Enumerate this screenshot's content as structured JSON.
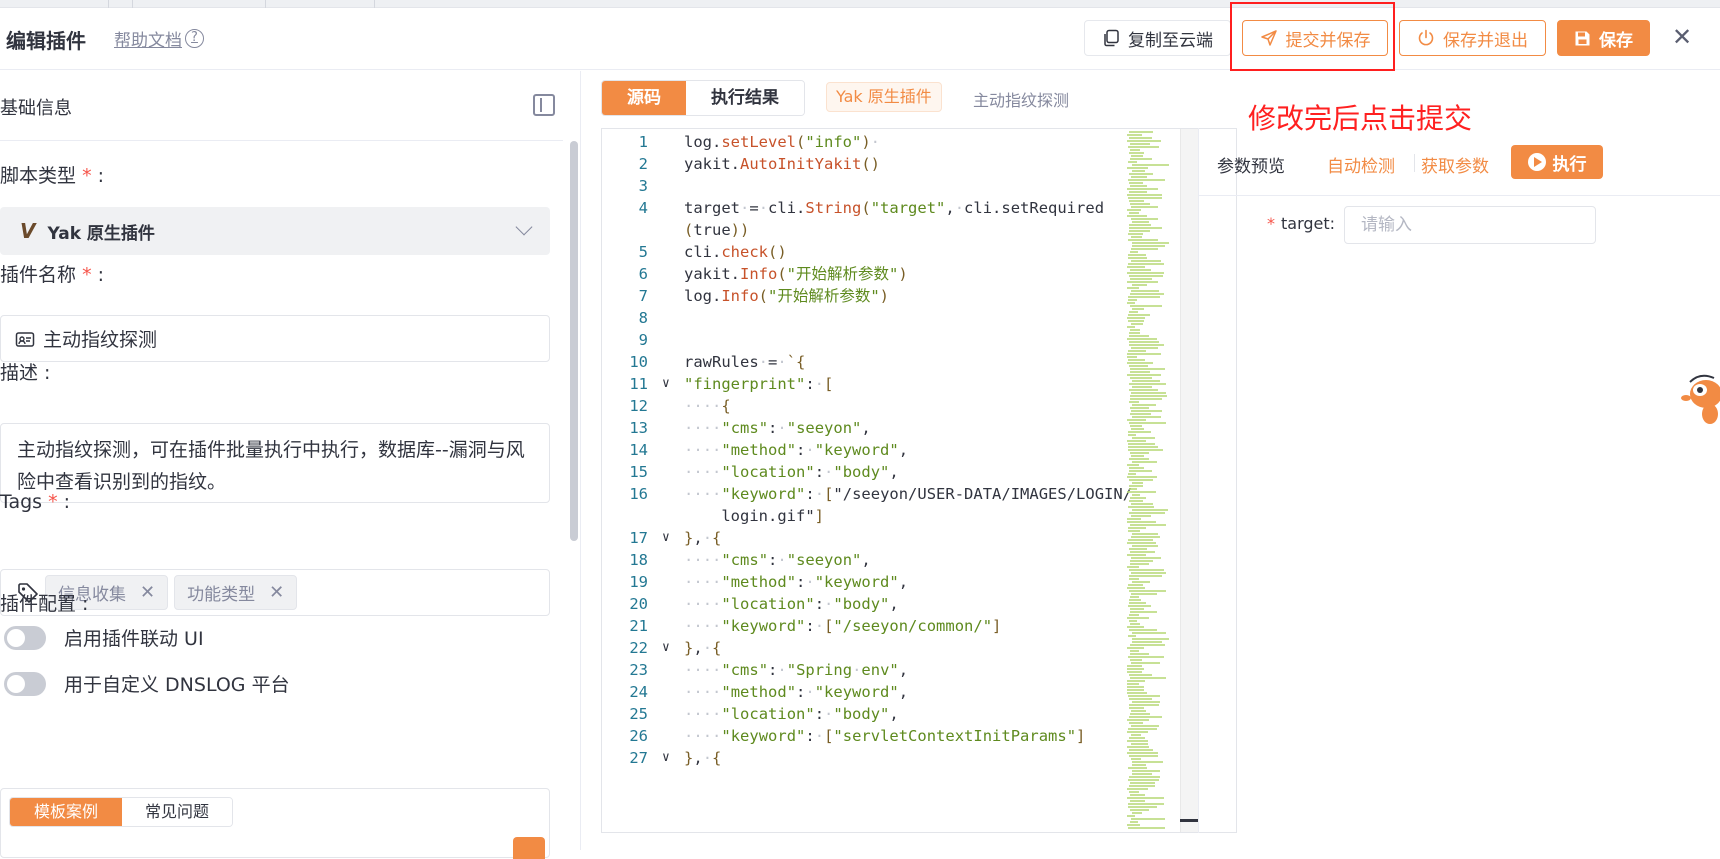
{
  "header": {
    "title": "编辑插件",
    "help_link": "帮助文档",
    "copy_cloud": "复制至云端",
    "submit_save": "提交并保存",
    "save_exit": "保存并退出",
    "save": "保存",
    "annotation": "修改完后点击提交"
  },
  "left": {
    "section_title": "基础信息",
    "script_type_label": "脚本类型",
    "script_type_value": "Yak 原生插件",
    "plugin_name_label": "插件名称",
    "plugin_name_value": "主动指纹探测",
    "desc_label": "描述",
    "desc_value": "主动指纹探测，可在插件批量执行中执行，数据库--漏洞与风险中查看识别到的指纹。",
    "tags_label": "Tags",
    "tags": [
      "信息收集",
      "功能类型"
    ],
    "config_label": "插件配置",
    "switch_linkage": "启用插件联动 UI",
    "switch_dnslog": "用于自定义 DNSLOG 平台",
    "tpl_tab_examples": "模板案例",
    "tpl_tab_faq": "常见问题"
  },
  "right": {
    "tab_source": "源码",
    "tab_result": "执行结果",
    "type_badge": "Yak 原生插件",
    "plugin_name": "主动指纹探测",
    "params_title": "参数预览",
    "auto_detect": "自动检测",
    "get_params": "获取参数",
    "run": "执行",
    "target_label": "target:",
    "target_placeholder": "请输入"
  },
  "code_lines": [
    {
      "n": "1",
      "fold": "",
      "text": "log.setLevel(\"info\")·"
    },
    {
      "n": "2",
      "fold": "",
      "text": "yakit.AutoInitYakit()"
    },
    {
      "n": "3",
      "fold": "",
      "text": ""
    },
    {
      "n": "4",
      "fold": "",
      "text": "target·=·cli.String(\"target\",·cli.setRequired"
    },
    {
      "n": "",
      "fold": "",
      "text": "(true))"
    },
    {
      "n": "5",
      "fold": "",
      "text": "cli.check()"
    },
    {
      "n": "6",
      "fold": "",
      "text": "yakit.Info(\"开始解析参数\")"
    },
    {
      "n": "7",
      "fold": "",
      "text": "log.Info(\"开始解析参数\")"
    },
    {
      "n": "8",
      "fold": "",
      "text": ""
    },
    {
      "n": "9",
      "fold": "",
      "text": ""
    },
    {
      "n": "10",
      "fold": "",
      "text": "rawRules·=·`{"
    },
    {
      "n": "11",
      "fold": "∨",
      "text": "\"fingerprint\":·["
    },
    {
      "n": "12",
      "fold": "",
      "text": "····{"
    },
    {
      "n": "13",
      "fold": "",
      "text": "····\"cms\":·\"seeyon\","
    },
    {
      "n": "14",
      "fold": "",
      "text": "····\"method\":·\"keyword\","
    },
    {
      "n": "15",
      "fold": "",
      "text": "····\"location\":·\"body\","
    },
    {
      "n": "16",
      "fold": "",
      "text": "····\"keyword\":·[\"/seeyon/USER-DATA/IMAGES/LOGIN/"
    },
    {
      "n": "",
      "fold": "",
      "text": "    login.gif\"]"
    },
    {
      "n": "17",
      "fold": "∨",
      "text": "},·{"
    },
    {
      "n": "18",
      "fold": "",
      "text": "····\"cms\":·\"seeyon\","
    },
    {
      "n": "19",
      "fold": "",
      "text": "····\"method\":·\"keyword\","
    },
    {
      "n": "20",
      "fold": "",
      "text": "····\"location\":·\"body\","
    },
    {
      "n": "21",
      "fold": "",
      "text": "····\"keyword\":·[\"/seeyon/common/\"]"
    },
    {
      "n": "22",
      "fold": "∨",
      "text": "},·{"
    },
    {
      "n": "23",
      "fold": "",
      "text": "····\"cms\":·\"Spring·env\","
    },
    {
      "n": "24",
      "fold": "",
      "text": "····\"method\":·\"keyword\","
    },
    {
      "n": "25",
      "fold": "",
      "text": "····\"location\":·\"body\","
    },
    {
      "n": "26",
      "fold": "",
      "text": "····\"keyword\":·[\"servletContextInitParams\"]"
    },
    {
      "n": "27",
      "fold": "∨",
      "text": "},·{"
    }
  ],
  "colors": {
    "accent": "#f28b44",
    "annotation_red": "#ff1f1f",
    "required": "#f6544a"
  }
}
